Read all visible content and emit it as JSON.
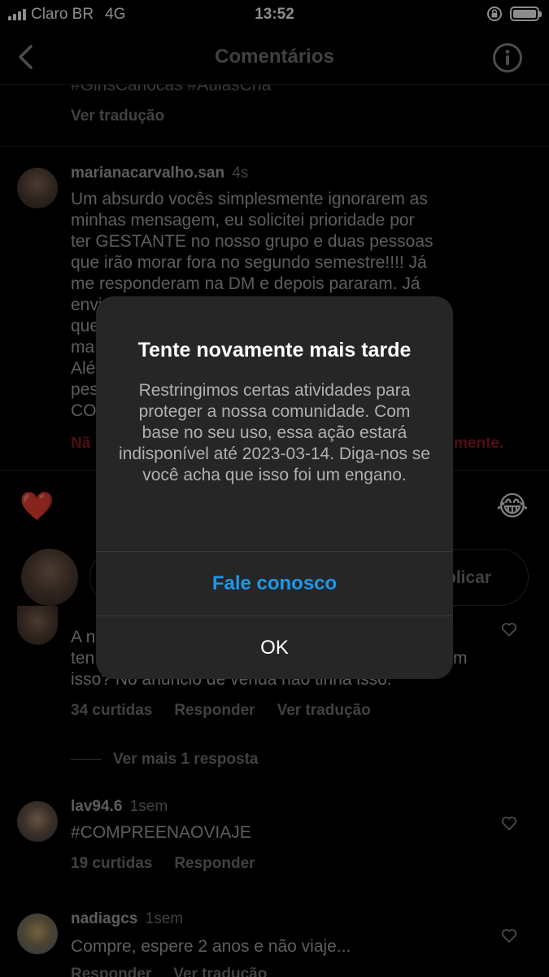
{
  "status_bar": {
    "carrier": "Claro BR",
    "network": "4G",
    "time": "13:52"
  },
  "header": {
    "title": "Comentários"
  },
  "feed": {
    "caption_tail": "#GirlsCariocas #AulasCha",
    "caption_translate": "Ver tradução",
    "comment1": {
      "user": "marianacarvalho.san",
      "time": "4s",
      "lines": [
        "Um absurdo vocês simplesmente ignorarem as",
        "minhas mensagem, eu solicitei prioridade por",
        "ter GESTANTE no nosso grupo e duas pessoas",
        "que irão morar fora no segundo semestre!!!! Já",
        "me responderam na DM e depois pararam. Já",
        "envi",
        "que",
        "ma",
        "Alé",
        "pes",
        "CO"
      ],
      "error_left": "Nã",
      "error_right": "mente."
    },
    "publish_label": "blicar",
    "comment2": {
      "lines": [
        "A n",
        "ten",
        "isso? No anúncio de venda não tinha isso."
      ],
      "tail_m": "m",
      "likes": "34 curtidas",
      "reply": "Responder",
      "translate": "Ver tradução",
      "more_replies": "Ver mais 1 resposta"
    },
    "comment3": {
      "user": "lav94.6",
      "time": "1sem",
      "text": "#COMPREENAOVIAJE",
      "likes": "19 curtidas",
      "reply": "Responder"
    },
    "comment4": {
      "user": "nadiagcs",
      "time": "1sem",
      "text": "Compre, espere 2 anos e não viaje...",
      "reply": "Responder",
      "translate": "Ver tradução"
    },
    "reactions": [
      "❤️",
      "🙌",
      "😮",
      "😂"
    ]
  },
  "modal": {
    "title": "Tente novamente mais tarde",
    "body": "Restringimos certas atividades para proteger a nossa comunidade. Com base no seu uso, essa ação estará indisponível até 2023-03-14. Diga-nos se você acha que isso foi um engano.",
    "primary_label": "Fale conosco",
    "secondary_label": "OK"
  },
  "colors": {
    "accent": "#1c98ea",
    "modal_bg": "#262626",
    "error": "#8e1b22"
  }
}
